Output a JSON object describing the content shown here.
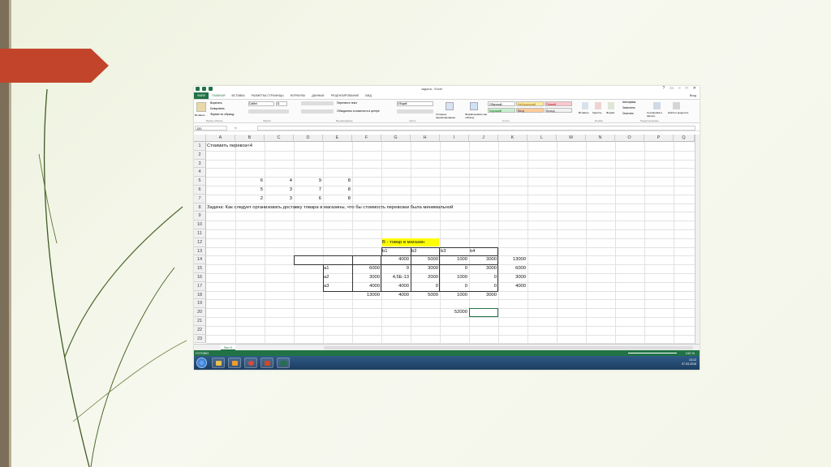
{
  "window": {
    "title": "задача - Excel",
    "controls": [
      "?",
      "▭",
      "–",
      "□",
      "✕"
    ],
    "user": "Вход"
  },
  "ribbon_tabs": [
    "ФАЙЛ",
    "ГЛАВНАЯ",
    "ВСТАВКА",
    "РАЗМЕТКА СТРАНИЦЫ",
    "ФОРМУЛЫ",
    "ДАННЫЕ",
    "РЕЦЕНЗИРОВАНИЕ",
    "ВИД"
  ],
  "ribbon": {
    "paste": "Вставить",
    "cut": "Вырезать",
    "copy": "Копировать",
    "format_painter": "Формат по образцу",
    "font_name": "Calibri",
    "font_size": "11",
    "wrap": "Перенести текст",
    "merge": "Объединить и поместить в центре",
    "number_format": "Общий",
    "conditional": "Условное форматирование",
    "format_table": "Форматировать как таблицу",
    "styles": {
      "normal": "Обычный",
      "neutral": "Нейтральный",
      "bad": "Плохой",
      "good": "Хороший",
      "check": "Ввод",
      "output": "Вывод"
    },
    "insert": "Вставить",
    "delete": "Удалить",
    "format": "Формат",
    "autosum": "Автосумма",
    "fill": "Заполнить",
    "clear": "Очистить",
    "sort": "Сортировка и фильтр",
    "find": "Найти и выделить",
    "groups": [
      "Буфер обмена",
      "Шрифт",
      "Выравнивание",
      "Число",
      "Стили",
      "Ячейки",
      "Редактирование"
    ]
  },
  "formula_bar": {
    "name_box": "J20",
    "fx": "fx",
    "content": ""
  },
  "columns": [
    "A",
    "B",
    "C",
    "D",
    "E",
    "F",
    "G",
    "H",
    "I",
    "J",
    "K",
    "L",
    "M",
    "N",
    "O",
    "P",
    "Q"
  ],
  "rows": [
    "1",
    "2",
    "3",
    "4",
    "5",
    "6",
    "7",
    "8",
    "9",
    "10",
    "11",
    "12",
    "13",
    "14",
    "15",
    "16",
    "17",
    "18",
    "19",
    "20",
    "21",
    "22",
    "23"
  ],
  "cells": {
    "a1": "Стоимить перевоз<4",
    "r5": [
      "6",
      "4",
      "9",
      "8"
    ],
    "r6": [
      "5",
      "3",
      "7",
      "8"
    ],
    "r7": [
      "2",
      "3",
      "6",
      "8"
    ],
    "a8": "Задача: Как следует организовать доставку товара в магазины, что бы стоимость перевозки была минимальной",
    "g12": "B - товар в магазин",
    "r13": [
      "b1",
      "b2",
      "b3",
      "b4"
    ],
    "r14": [
      "4000",
      "5000",
      "1000",
      "3000",
      "13000"
    ],
    "r15": [
      "a1",
      "6000",
      "0",
      "3000",
      "0",
      "3000",
      "6000"
    ],
    "r16": [
      "a2",
      "3000",
      "4,5E-13",
      "2000",
      "1000",
      "0",
      "3000"
    ],
    "r17": [
      "a3",
      "4000",
      "4000",
      "0",
      "0",
      "0",
      "4000"
    ],
    "r18": [
      "13000",
      "4000",
      "5000",
      "1000",
      "3000"
    ],
    "i20": "52000"
  },
  "sheet_tab": "Лист1",
  "status": "ГОТОВО",
  "zoom": "100 %",
  "tray": {
    "time": "13:12",
    "date": "07.03.2016"
  }
}
